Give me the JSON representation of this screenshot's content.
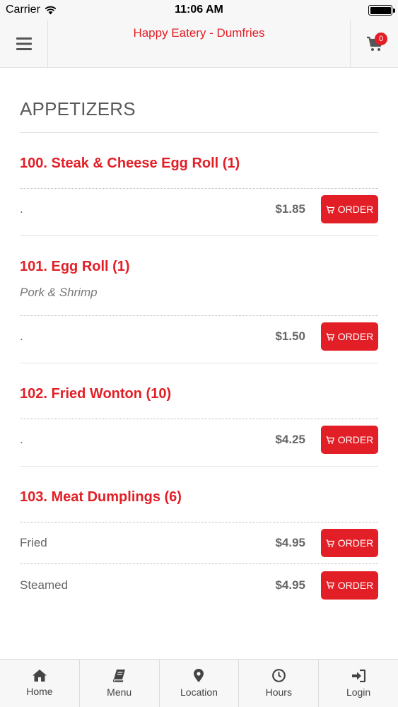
{
  "status_bar": {
    "carrier": "Carrier",
    "time": "11:06 AM"
  },
  "header": {
    "title": "Happy Eatery - Dumfries",
    "cart_count": "0",
    "menu_icon": "hamburger-icon",
    "cart_icon": "cart-icon"
  },
  "section": {
    "title": "APPETIZERS"
  },
  "items": [
    {
      "name": "100. Steak & Cheese Egg Roll (1)",
      "description": "",
      "options": [
        {
          "label": ".",
          "price": "$1.85",
          "button": "ORDER"
        }
      ]
    },
    {
      "name": "101. Egg Roll (1)",
      "description": "Pork & Shrimp",
      "options": [
        {
          "label": ".",
          "price": "$1.50",
          "button": "ORDER"
        }
      ]
    },
    {
      "name": "102. Fried Wonton (10)",
      "description": "",
      "options": [
        {
          "label": ".",
          "price": "$4.25",
          "button": "ORDER"
        }
      ]
    },
    {
      "name": "103. Meat Dumplings (6)",
      "description": "",
      "options": [
        {
          "label": "Fried",
          "price": "$4.95",
          "button": "ORDER"
        },
        {
          "label": "Steamed",
          "price": "$4.95",
          "button": "ORDER"
        }
      ]
    }
  ],
  "bottom_nav": [
    {
      "label": "Home",
      "icon": "home-icon"
    },
    {
      "label": "Menu",
      "icon": "book-icon"
    },
    {
      "label": "Location",
      "icon": "map-pin-icon"
    },
    {
      "label": "Hours",
      "icon": "clock-icon"
    },
    {
      "label": "Login",
      "icon": "sign-in-icon"
    }
  ],
  "colors": {
    "accent": "#e21f26",
    "bar_bg": "#f7f7f7",
    "text": "#555555"
  }
}
